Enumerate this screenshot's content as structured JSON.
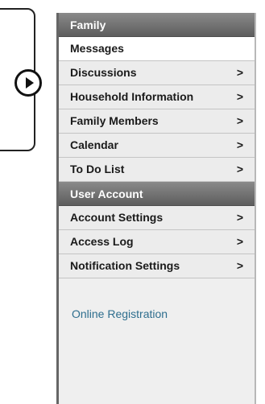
{
  "sections": [
    {
      "title": "Family",
      "items": [
        {
          "label": "Messages",
          "chevron": "",
          "active": true
        },
        {
          "label": "Discussions",
          "chevron": ">"
        },
        {
          "label": "Household Information",
          "chevron": ">"
        },
        {
          "label": "Family Members",
          "chevron": ">"
        },
        {
          "label": "Calendar",
          "chevron": ">"
        },
        {
          "label": "To Do List",
          "chevron": ">"
        }
      ]
    },
    {
      "title": "User Account",
      "items": [
        {
          "label": "Account Settings",
          "chevron": ">"
        },
        {
          "label": "Access Log",
          "chevron": ">"
        },
        {
          "label": "Notification Settings",
          "chevron": ">"
        }
      ]
    }
  ],
  "footer_link": "Online Registration",
  "icons": {
    "expand": "circle-right-arrow-icon",
    "chevron": "chevron-right-icon"
  },
  "colors": {
    "header_gradient_top": "#8a8a8a",
    "header_gradient_bottom": "#5d5d5d",
    "link": "#2e6e8e",
    "panel_bg": "#efefef"
  }
}
